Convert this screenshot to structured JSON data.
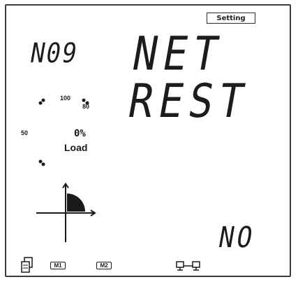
{
  "setting_label": "Setting",
  "menu_number": "N09",
  "title_line1": "NET",
  "title_line2": "REST",
  "value": "NO",
  "gauge": {
    "tick_100": "100",
    "tick_80": "80",
    "tick_50": "50",
    "load_percent": "0%",
    "load_label": "Load"
  },
  "status": {
    "m1": "M1",
    "m2": "M2"
  },
  "icons": [
    "document-icon",
    "m1-icon",
    "m2-icon",
    "network-link-icon",
    "quadrant-icon"
  ]
}
